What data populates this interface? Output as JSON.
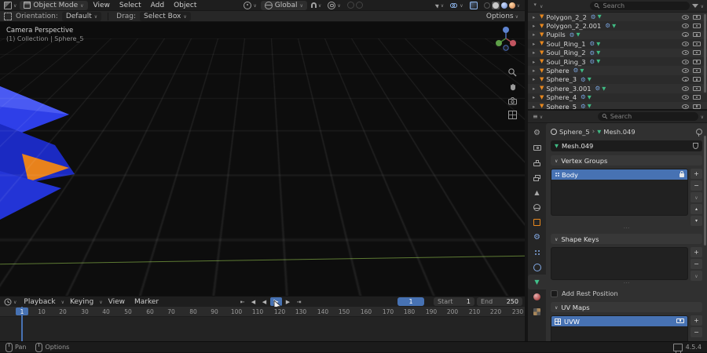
{
  "colors": {
    "accent": "#4772b3",
    "object_orange": "#e8881e",
    "data_green": "#3fba83",
    "modifier_blue": "#7aa5e0"
  },
  "icons": {
    "search-icon": "magnifier",
    "chevron-down-icon": "∨",
    "expand-arrow-icon": "▸",
    "mesh-object-icon": "orange triangle",
    "modifier-icon": "blue gear",
    "mesh-data-icon": "green triangle",
    "eye-icon": "visibility toggle",
    "camera-icon": "render visibility toggle",
    "clock-icon": "timeline editor",
    "filter-icon": "funnel",
    "lock-icon": "padlock",
    "pin-icon": "pin",
    "mouse-icon": "mouse",
    "gpu-icon": "chip"
  },
  "top_header": {
    "mode_label": "Object Mode",
    "menus": [
      "View",
      "Select",
      "Add",
      "Object"
    ],
    "orientation_value": "Global"
  },
  "tool_settings": {
    "orientation_label": "Orientation:",
    "orientation_value": "Default",
    "drag_label": "Drag:",
    "drag_value": "Select Box",
    "options_label": "Options"
  },
  "viewport": {
    "view_label": "Camera Perspective",
    "context_label": "(1) Collection | Sphere_5"
  },
  "outliner": {
    "search_placeholder": "Search",
    "rows": [
      {
        "name": "Polygon_2_2"
      },
      {
        "name": "Polygon_2_2.001"
      },
      {
        "name": "Pupils"
      },
      {
        "name": "Soul_Ring_1"
      },
      {
        "name": "Soul_Ring_2"
      },
      {
        "name": "Soul_Ring_3"
      },
      {
        "name": "Sphere"
      },
      {
        "name": "Sphere_3"
      },
      {
        "name": "Sphere_3.001"
      },
      {
        "name": "Sphere_4"
      },
      {
        "name": "Sphere_5"
      }
    ]
  },
  "properties": {
    "search_placeholder": "Search",
    "breadcrumb": {
      "object": "Sphere_5",
      "separator": "›",
      "data": "Mesh.049"
    },
    "mesh_name": "Mesh.049",
    "tabs": [
      {
        "icon": "tool-icon"
      },
      {
        "icon": "render-icon"
      },
      {
        "icon": "output-icon"
      },
      {
        "icon": "view-layer-icon"
      },
      {
        "icon": "scene-icon"
      },
      {
        "icon": "world-icon"
      },
      {
        "icon": "object-icon"
      },
      {
        "icon": "modifiers-icon"
      },
      {
        "icon": "particles-icon"
      },
      {
        "icon": "physics-icon"
      },
      {
        "icon": "object-data-icon"
      },
      {
        "icon": "material-icon"
      },
      {
        "icon": "texture-icon"
      }
    ],
    "vertex_groups": {
      "title": "Vertex Groups",
      "items": [
        {
          "name": "Body"
        }
      ]
    },
    "shape_keys": {
      "title": "Shape Keys"
    },
    "rest_position_label": "Add Rest Position",
    "uv_maps": {
      "title": "UV Maps",
      "items": [
        {
          "name": "UVW"
        }
      ]
    }
  },
  "timeline": {
    "menus": [
      "Playback",
      "Keying",
      "View",
      "Marker"
    ],
    "current_frame": "1",
    "start": {
      "label": "Start",
      "value": "1"
    },
    "end": {
      "label": "End",
      "value": "250"
    },
    "playhead": {
      "frame": "1"
    },
    "ruler": [
      "1",
      "10",
      "20",
      "30",
      "40",
      "50",
      "60",
      "70",
      "80",
      "90",
      "100",
      "110",
      "120",
      "130",
      "140",
      "150",
      "160",
      "170",
      "180",
      "190",
      "200",
      "210",
      "220",
      "230"
    ]
  },
  "status_bar": {
    "pan_label": "Pan",
    "options_label": "Options",
    "version": "4.5.4"
  }
}
